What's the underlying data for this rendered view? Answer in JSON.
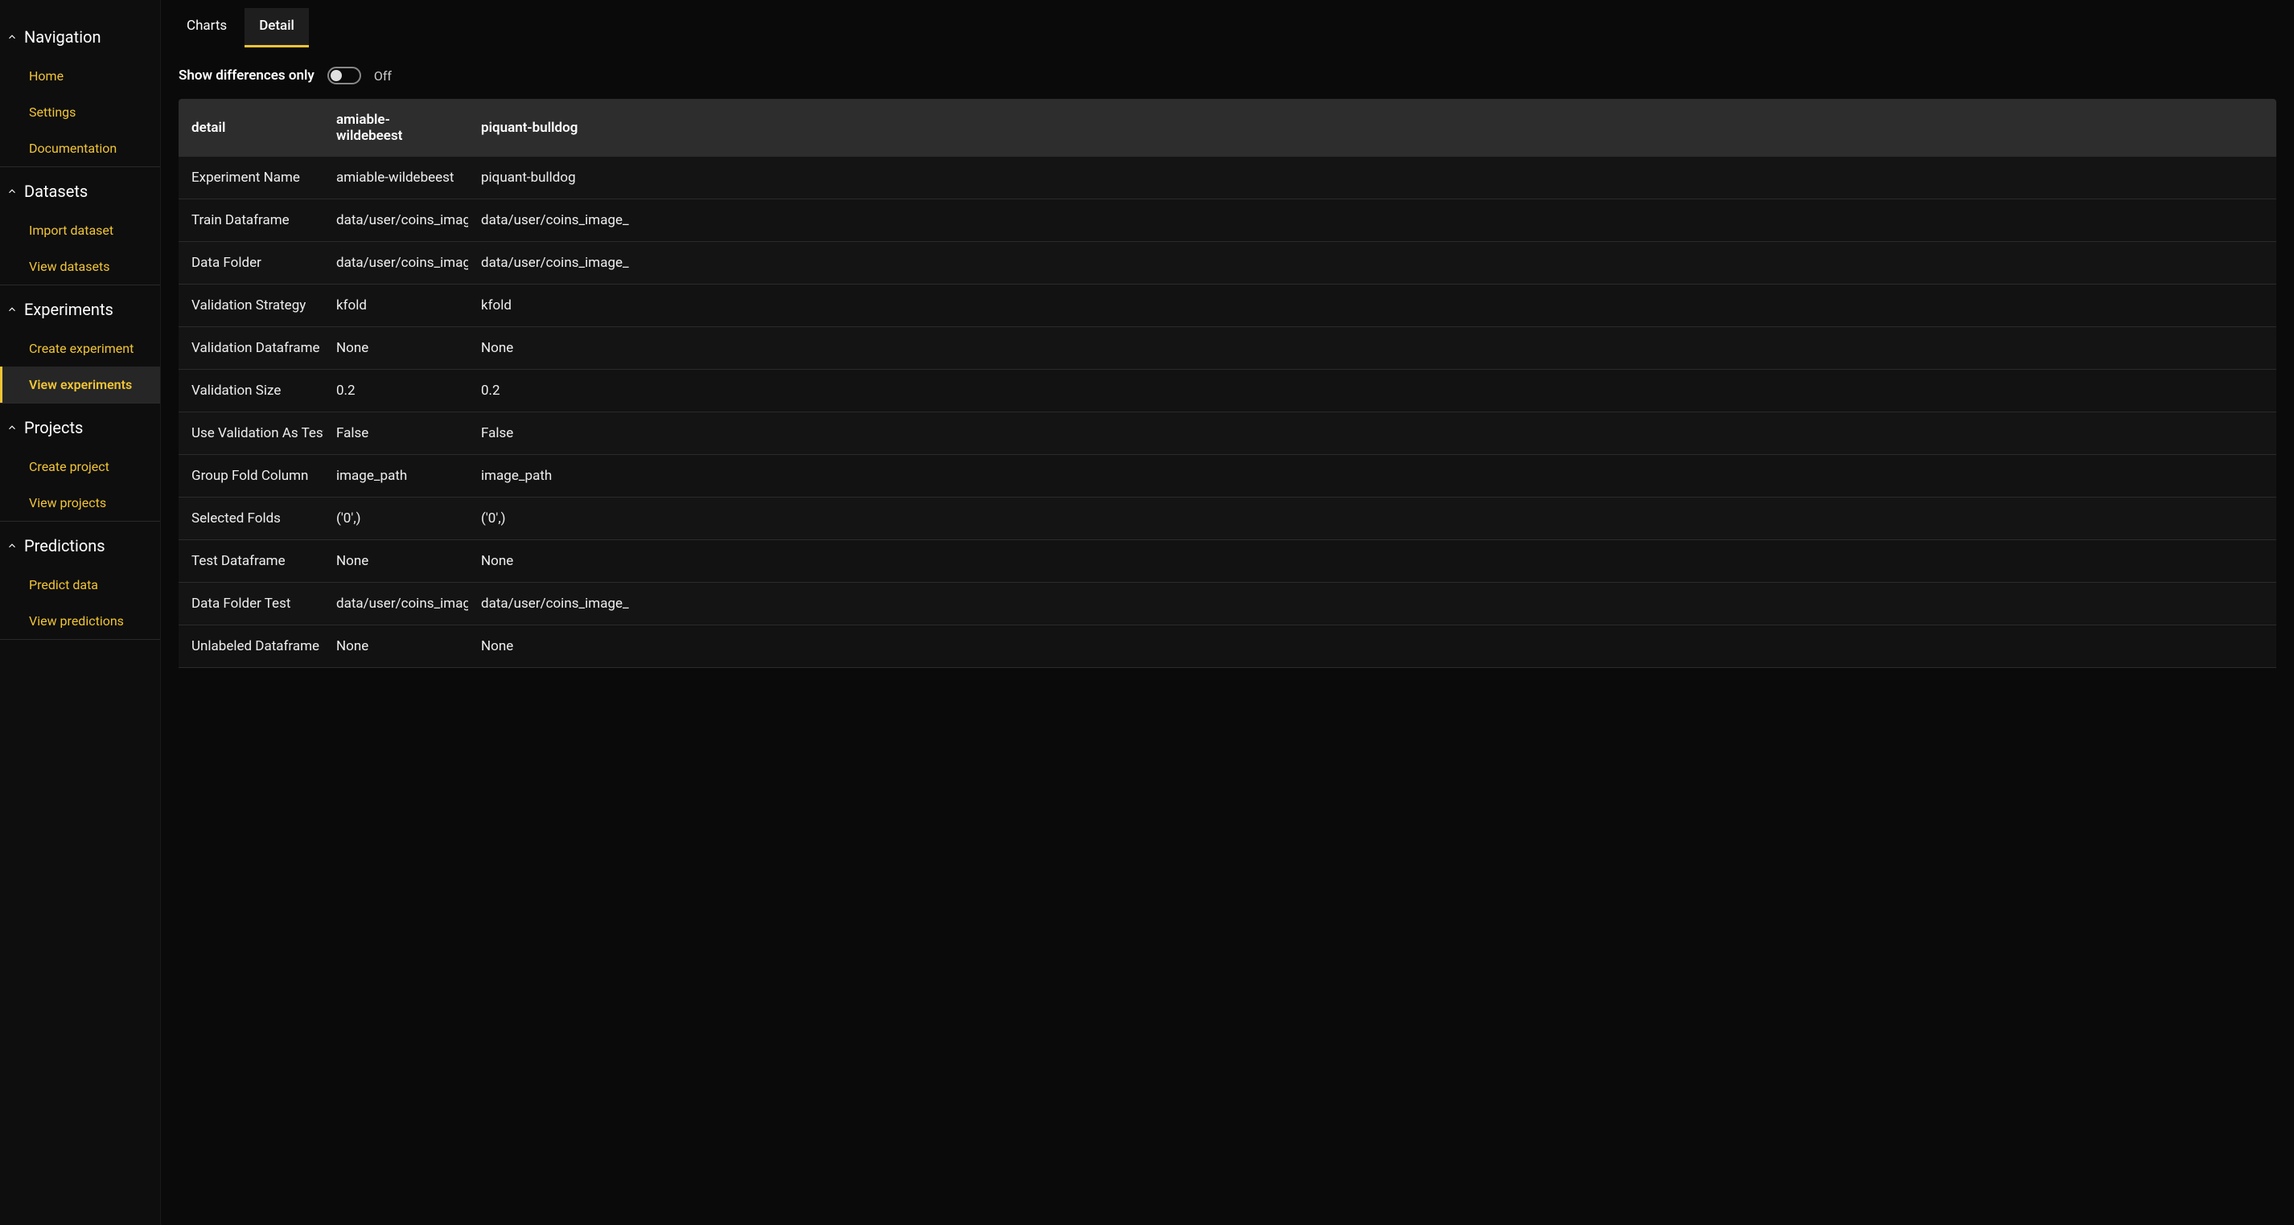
{
  "sidebar": {
    "sections": [
      {
        "title": "Navigation",
        "items": [
          {
            "label": "Home",
            "active": false
          },
          {
            "label": "Settings",
            "active": false
          },
          {
            "label": "Documentation",
            "active": false
          }
        ]
      },
      {
        "title": "Datasets",
        "items": [
          {
            "label": "Import dataset",
            "active": false
          },
          {
            "label": "View datasets",
            "active": false
          }
        ]
      },
      {
        "title": "Experiments",
        "items": [
          {
            "label": "Create experiment",
            "active": false
          },
          {
            "label": "View experiments",
            "active": true
          }
        ]
      },
      {
        "title": "Projects",
        "items": [
          {
            "label": "Create project",
            "active": false
          },
          {
            "label": "View projects",
            "active": false
          }
        ]
      },
      {
        "title": "Predictions",
        "items": [
          {
            "label": "Predict data",
            "active": false
          },
          {
            "label": "View predictions",
            "active": false
          }
        ]
      }
    ]
  },
  "tabs": [
    {
      "label": "Charts",
      "active": false
    },
    {
      "label": "Detail",
      "active": true
    }
  ],
  "diff_toggle": {
    "label": "Show differences only",
    "state": "Off"
  },
  "table": {
    "headers": [
      "detail",
      "amiable-wildebeest",
      "piquant-bulldog"
    ],
    "rows": [
      [
        "Experiment Name",
        "amiable-wildebeest",
        "piquant-bulldog"
      ],
      [
        "Train Dataframe",
        "data/user/coins_image_",
        "data/user/coins_image_"
      ],
      [
        "Data Folder",
        "data/user/coins_image_",
        "data/user/coins_image_"
      ],
      [
        "Validation Strategy",
        "kfold",
        "kfold"
      ],
      [
        "Validation Dataframe",
        "None",
        "None"
      ],
      [
        "Validation Size",
        "0.2",
        "0.2"
      ],
      [
        "Use Validation As Test D",
        "False",
        "False"
      ],
      [
        "Group Fold Column",
        "image_path",
        "image_path"
      ],
      [
        "Selected Folds",
        "('0',)",
        "('0',)"
      ],
      [
        "Test Dataframe",
        "None",
        "None"
      ],
      [
        "Data Folder Test",
        "data/user/coins_image_",
        "data/user/coins_image_"
      ],
      [
        "Unlabeled Dataframe",
        "None",
        "None"
      ]
    ]
  }
}
